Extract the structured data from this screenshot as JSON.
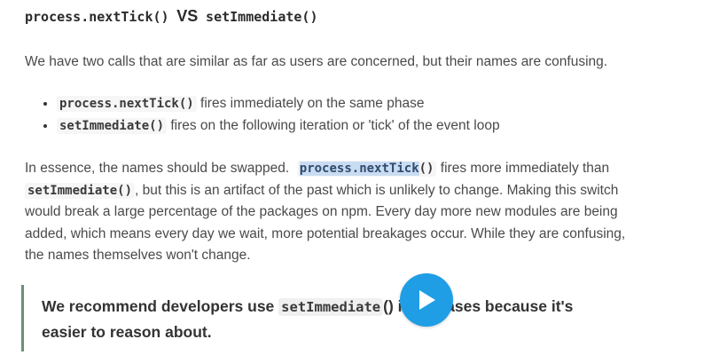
{
  "heading": {
    "code1": "process.nextTick()",
    "vs": "VS",
    "code2": "setImmediate()"
  },
  "intro": "We have two calls that are similar as far as users are concerned, but their names are confusing.",
  "bullets": [
    {
      "code": "process.nextTick()",
      "text": "fires immediately on the same phase"
    },
    {
      "code": "setImmediate()",
      "text": "fires on the following iteration or 'tick' of the event loop"
    }
  ],
  "paragraph": {
    "line1_pre": "In essence, the names should be swapped.",
    "line1_selected": "process.nextTick",
    "line1_code_rest": "()",
    "line1_post": "fires more immediately than",
    "line2_code": "setImmediate()",
    "line2_post": ", but this is an artifact of the past which is unlikely to change. Making this switch",
    "line3": "would break a large percentage of the packages on npm. Every day more new modules are being",
    "line4": "added, which means every day we wait, more potential breakages occur. While they are confusing,",
    "line5": "the names themselves won't change."
  },
  "callout": {
    "pre": "We recommend developers use",
    "code": "setImmediate",
    "hidden": "() in al",
    "post": "l cases because it's",
    "line2": "easier to reason about."
  },
  "video": {
    "play_icon": "play-icon",
    "color": "#1f9ee6"
  }
}
